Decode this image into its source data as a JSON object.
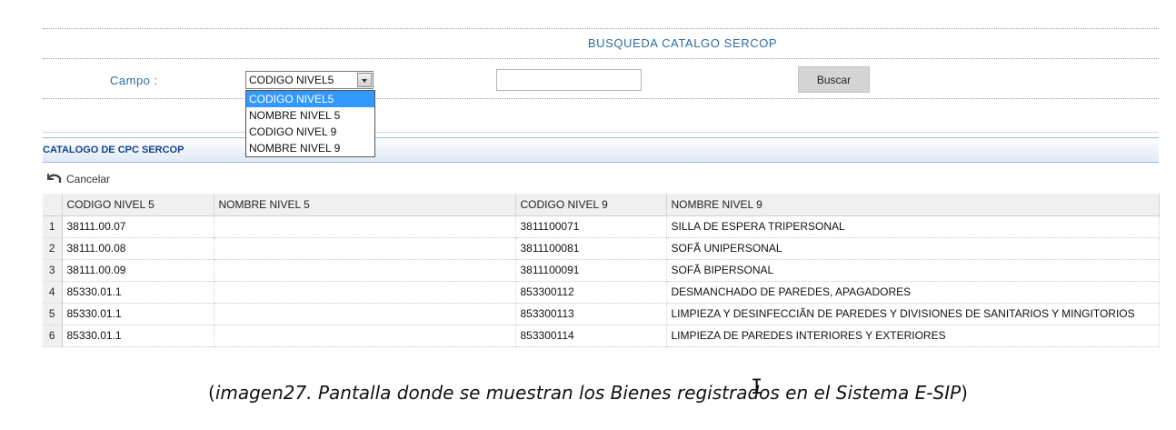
{
  "search": {
    "title": "BUSQUEDA CATALGO SERCOP",
    "campo_label": "Campo :",
    "selected_field": "CODIGO NIVEL5",
    "field_options": [
      "CODIGO NIVEL5",
      "NOMBRE NIVEL 5",
      "CODIGO NIVEL 9",
      "NOMBRE NIVEL 9"
    ],
    "input_value": "",
    "buscar_label": "Buscar"
  },
  "grid": {
    "title": "CATALOGO DE CPC SERCOP",
    "toolbar": {
      "cancel_label": "Cancelar",
      "cancel_icon": "undo-icon"
    },
    "columns": [
      "CODIGO NIVEL 5",
      "NOMBRE NIVEL 5",
      "CODIGO NIVEL 9",
      "NOMBRE NIVEL 9"
    ],
    "rows": [
      {
        "num": "1",
        "codigo5": "38111.00.07",
        "nombre5": "",
        "codigo9": "3811100071",
        "nombre9": "SILLA DE ESPERA TRIPERSONAL"
      },
      {
        "num": "2",
        "codigo5": "38111.00.08",
        "nombre5": "",
        "codigo9": "3811100081",
        "nombre9": "SOFÃ UNIPERSONAL"
      },
      {
        "num": "3",
        "codigo5": "38111.00.09",
        "nombre5": "",
        "codigo9": "3811100091",
        "nombre9": "SOFÃ BIPERSONAL"
      },
      {
        "num": "4",
        "codigo5": "85330.01.1",
        "nombre5": "",
        "codigo9": "853300112",
        "nombre9": "DESMANCHADO DE PAREDES, APAGADORES"
      },
      {
        "num": "5",
        "codigo5": "85330.01.1",
        "nombre5": "",
        "codigo9": "853300113",
        "nombre9": "LIMPIEZA Y DESINFECCIÃN DE PAREDES Y DIVISIONES DE SANITARIOS Y MINGITORIOS"
      },
      {
        "num": "6",
        "codigo5": "85330.01.1",
        "nombre5": "",
        "codigo9": "853300114",
        "nombre9": "LIMPIEZA DE PAREDES INTERIORES Y EXTERIORES"
      }
    ]
  },
  "caption": {
    "open": "(",
    "text": "imagen27. Pantalla donde se muestran los Bienes registrados en el Sistema E-SIP",
    "close": ")"
  },
  "colors": {
    "accent": "#2b6ca3",
    "grid_title": "#15428b",
    "selected_option": "#3399ff"
  }
}
